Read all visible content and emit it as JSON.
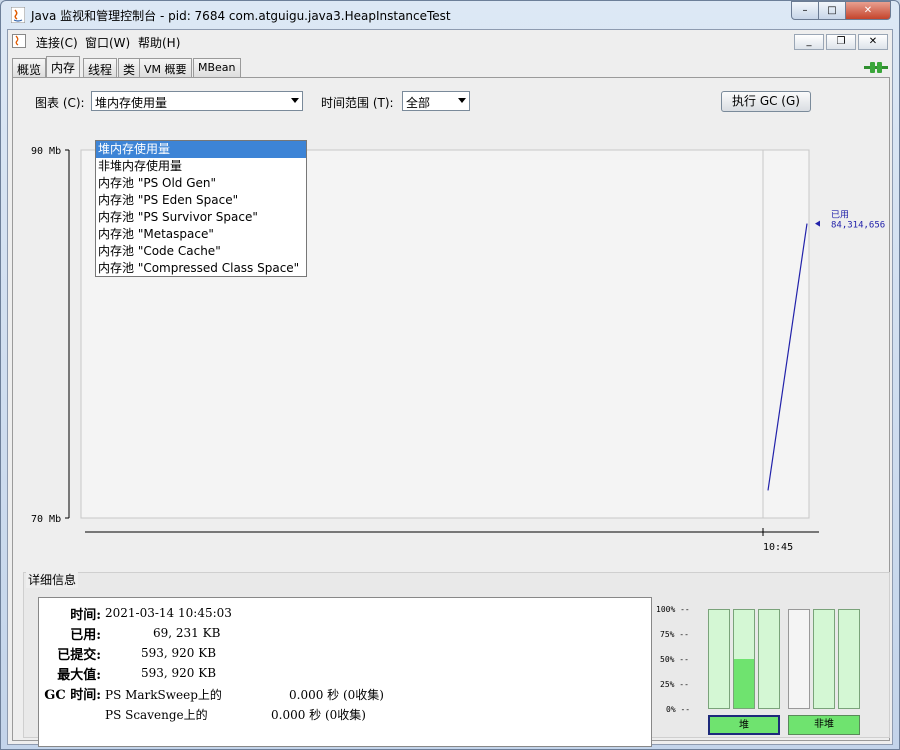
{
  "window": {
    "title": "Java 监视和管理控制台 - pid: 7684 com.atguigu.java3.HeapInstanceTest",
    "buttons": {
      "minimize": "–",
      "maximize": "□",
      "close": "✕"
    }
  },
  "menubar": {
    "items": [
      "连接(C)",
      "窗口(W)",
      "帮助(H)"
    ],
    "inner_buttons": [
      "_",
      "❐",
      "✕"
    ]
  },
  "tabs": [
    "概览",
    "内存",
    "线程",
    "类",
    "VM 概要",
    "MBean"
  ],
  "controls": {
    "chart_label": "图表 (C):",
    "chart_selected": "堆内存使用量",
    "time_range_label": "时间范围 (T):",
    "time_range_selected": "全部",
    "gc_button": "执行 GC (G)"
  },
  "dropdown_options": [
    "堆内存使用量",
    "非堆内存使用量",
    "内存池 \"PS Old Gen\"",
    "内存池 \"PS Eden Space\"",
    "内存池 \"PS Survivor Space\"",
    "内存池 \"Metaspace\"",
    "内存池 \"Code Cache\"",
    "内存池 \"Compressed Class Space\""
  ],
  "chart_data": {
    "type": "line",
    "ylim": [
      70,
      90
    ],
    "y_ticks": [
      "90 Mb",
      "70 Mb"
    ],
    "x_ticks": [
      "10:45"
    ],
    "series": [
      {
        "name": "已用",
        "value_label": "84,314,656",
        "color": "#2222aa",
        "values": [
          71.5,
          86.0
        ]
      }
    ],
    "grid": false
  },
  "details": {
    "title": "详细信息",
    "rows": [
      {
        "label": "时间:",
        "value": "2021-03-14 10:45:03"
      },
      {
        "label": "已用:",
        "value": "69, 231 KB"
      },
      {
        "label": "已提交:",
        "value": "593, 920 KB"
      },
      {
        "label": "最大值:",
        "value": "593, 920 KB"
      },
      {
        "label": "GC 时间:",
        "value": "PS MarkSweep上的",
        "value2": "0.000  秒 (0收集)"
      },
      {
        "label": "",
        "value": "PS Scavenge上的",
        "value2": "0.000  秒 (0收集)"
      }
    ]
  },
  "usage_bars": {
    "y_ticks": [
      "100% --",
      "75% --",
      "50% --",
      "25% --",
      "0% --"
    ],
    "heap_fills": [
      0.0,
      0.5,
      0.0
    ],
    "nonheap_fills": [
      0.0,
      0.0,
      0.0
    ],
    "heap_label": "堆",
    "nonheap_label": "非堆"
  }
}
